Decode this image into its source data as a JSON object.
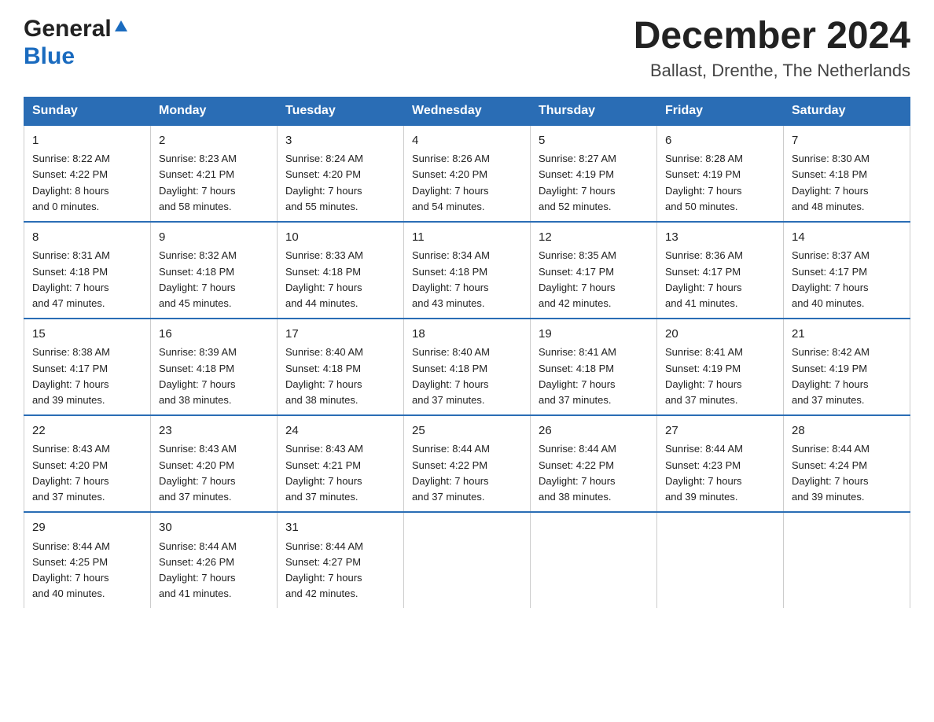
{
  "logo": {
    "general": "General",
    "blue": "Blue"
  },
  "header": {
    "title": "December 2024",
    "subtitle": "Ballast, Drenthe, The Netherlands"
  },
  "weekdays": [
    "Sunday",
    "Monday",
    "Tuesday",
    "Wednesday",
    "Thursday",
    "Friday",
    "Saturday"
  ],
  "weeks": [
    [
      {
        "day": "1",
        "info": "Sunrise: 8:22 AM\nSunset: 4:22 PM\nDaylight: 8 hours\nand 0 minutes."
      },
      {
        "day": "2",
        "info": "Sunrise: 8:23 AM\nSunset: 4:21 PM\nDaylight: 7 hours\nand 58 minutes."
      },
      {
        "day": "3",
        "info": "Sunrise: 8:24 AM\nSunset: 4:20 PM\nDaylight: 7 hours\nand 55 minutes."
      },
      {
        "day": "4",
        "info": "Sunrise: 8:26 AM\nSunset: 4:20 PM\nDaylight: 7 hours\nand 54 minutes."
      },
      {
        "day": "5",
        "info": "Sunrise: 8:27 AM\nSunset: 4:19 PM\nDaylight: 7 hours\nand 52 minutes."
      },
      {
        "day": "6",
        "info": "Sunrise: 8:28 AM\nSunset: 4:19 PM\nDaylight: 7 hours\nand 50 minutes."
      },
      {
        "day": "7",
        "info": "Sunrise: 8:30 AM\nSunset: 4:18 PM\nDaylight: 7 hours\nand 48 minutes."
      }
    ],
    [
      {
        "day": "8",
        "info": "Sunrise: 8:31 AM\nSunset: 4:18 PM\nDaylight: 7 hours\nand 47 minutes."
      },
      {
        "day": "9",
        "info": "Sunrise: 8:32 AM\nSunset: 4:18 PM\nDaylight: 7 hours\nand 45 minutes."
      },
      {
        "day": "10",
        "info": "Sunrise: 8:33 AM\nSunset: 4:18 PM\nDaylight: 7 hours\nand 44 minutes."
      },
      {
        "day": "11",
        "info": "Sunrise: 8:34 AM\nSunset: 4:18 PM\nDaylight: 7 hours\nand 43 minutes."
      },
      {
        "day": "12",
        "info": "Sunrise: 8:35 AM\nSunset: 4:17 PM\nDaylight: 7 hours\nand 42 minutes."
      },
      {
        "day": "13",
        "info": "Sunrise: 8:36 AM\nSunset: 4:17 PM\nDaylight: 7 hours\nand 41 minutes."
      },
      {
        "day": "14",
        "info": "Sunrise: 8:37 AM\nSunset: 4:17 PM\nDaylight: 7 hours\nand 40 minutes."
      }
    ],
    [
      {
        "day": "15",
        "info": "Sunrise: 8:38 AM\nSunset: 4:17 PM\nDaylight: 7 hours\nand 39 minutes."
      },
      {
        "day": "16",
        "info": "Sunrise: 8:39 AM\nSunset: 4:18 PM\nDaylight: 7 hours\nand 38 minutes."
      },
      {
        "day": "17",
        "info": "Sunrise: 8:40 AM\nSunset: 4:18 PM\nDaylight: 7 hours\nand 38 minutes."
      },
      {
        "day": "18",
        "info": "Sunrise: 8:40 AM\nSunset: 4:18 PM\nDaylight: 7 hours\nand 37 minutes."
      },
      {
        "day": "19",
        "info": "Sunrise: 8:41 AM\nSunset: 4:18 PM\nDaylight: 7 hours\nand 37 minutes."
      },
      {
        "day": "20",
        "info": "Sunrise: 8:41 AM\nSunset: 4:19 PM\nDaylight: 7 hours\nand 37 minutes."
      },
      {
        "day": "21",
        "info": "Sunrise: 8:42 AM\nSunset: 4:19 PM\nDaylight: 7 hours\nand 37 minutes."
      }
    ],
    [
      {
        "day": "22",
        "info": "Sunrise: 8:43 AM\nSunset: 4:20 PM\nDaylight: 7 hours\nand 37 minutes."
      },
      {
        "day": "23",
        "info": "Sunrise: 8:43 AM\nSunset: 4:20 PM\nDaylight: 7 hours\nand 37 minutes."
      },
      {
        "day": "24",
        "info": "Sunrise: 8:43 AM\nSunset: 4:21 PM\nDaylight: 7 hours\nand 37 minutes."
      },
      {
        "day": "25",
        "info": "Sunrise: 8:44 AM\nSunset: 4:22 PM\nDaylight: 7 hours\nand 37 minutes."
      },
      {
        "day": "26",
        "info": "Sunrise: 8:44 AM\nSunset: 4:22 PM\nDaylight: 7 hours\nand 38 minutes."
      },
      {
        "day": "27",
        "info": "Sunrise: 8:44 AM\nSunset: 4:23 PM\nDaylight: 7 hours\nand 39 minutes."
      },
      {
        "day": "28",
        "info": "Sunrise: 8:44 AM\nSunset: 4:24 PM\nDaylight: 7 hours\nand 39 minutes."
      }
    ],
    [
      {
        "day": "29",
        "info": "Sunrise: 8:44 AM\nSunset: 4:25 PM\nDaylight: 7 hours\nand 40 minutes."
      },
      {
        "day": "30",
        "info": "Sunrise: 8:44 AM\nSunset: 4:26 PM\nDaylight: 7 hours\nand 41 minutes."
      },
      {
        "day": "31",
        "info": "Sunrise: 8:44 AM\nSunset: 4:27 PM\nDaylight: 7 hours\nand 42 minutes."
      },
      {
        "day": "",
        "info": ""
      },
      {
        "day": "",
        "info": ""
      },
      {
        "day": "",
        "info": ""
      },
      {
        "day": "",
        "info": ""
      }
    ]
  ]
}
